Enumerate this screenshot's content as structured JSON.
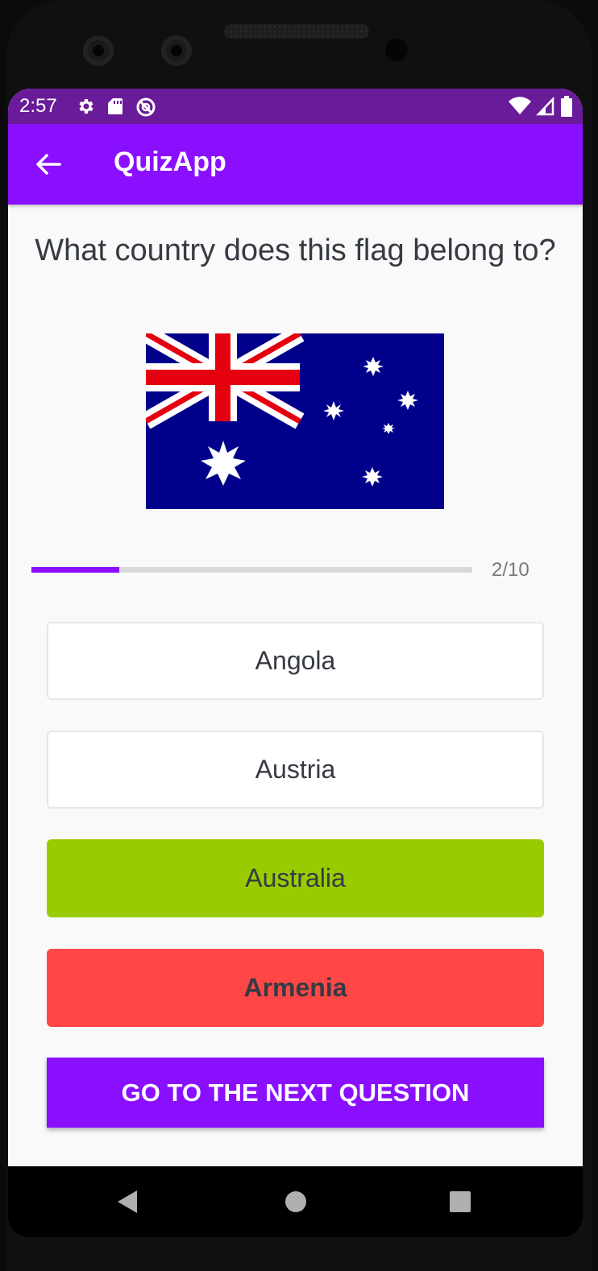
{
  "status_bar": {
    "time": "2:57",
    "background": "#6a1b9a",
    "left_icons": [
      "gear-icon",
      "sd-card-icon",
      "no-sync-icon"
    ],
    "right_icons": [
      "wifi-icon",
      "signal-icon",
      "battery-icon"
    ]
  },
  "app_bar": {
    "title": "QuizApp",
    "back_icon": "arrow-back-icon",
    "background": "#8a0fff"
  },
  "quiz": {
    "question": "What country does this flag belong to?",
    "image": "flag-of-australia",
    "progress": {
      "current": 2,
      "total": 10,
      "label": "2/10",
      "fraction": 0.2
    },
    "options": [
      {
        "label": "Angola",
        "state": "neutral"
      },
      {
        "label": "Austria",
        "state": "neutral"
      },
      {
        "label": "Australia",
        "state": "correct",
        "color": "#99cc00"
      },
      {
        "label": "Armenia",
        "state": "wrong",
        "color": "#ff4747"
      }
    ],
    "submit_label": "GO TO THE NEXT QUESTION"
  },
  "nav_bar": {
    "buttons": [
      "back-triangle-icon",
      "home-circle-icon",
      "recents-square-icon"
    ]
  }
}
